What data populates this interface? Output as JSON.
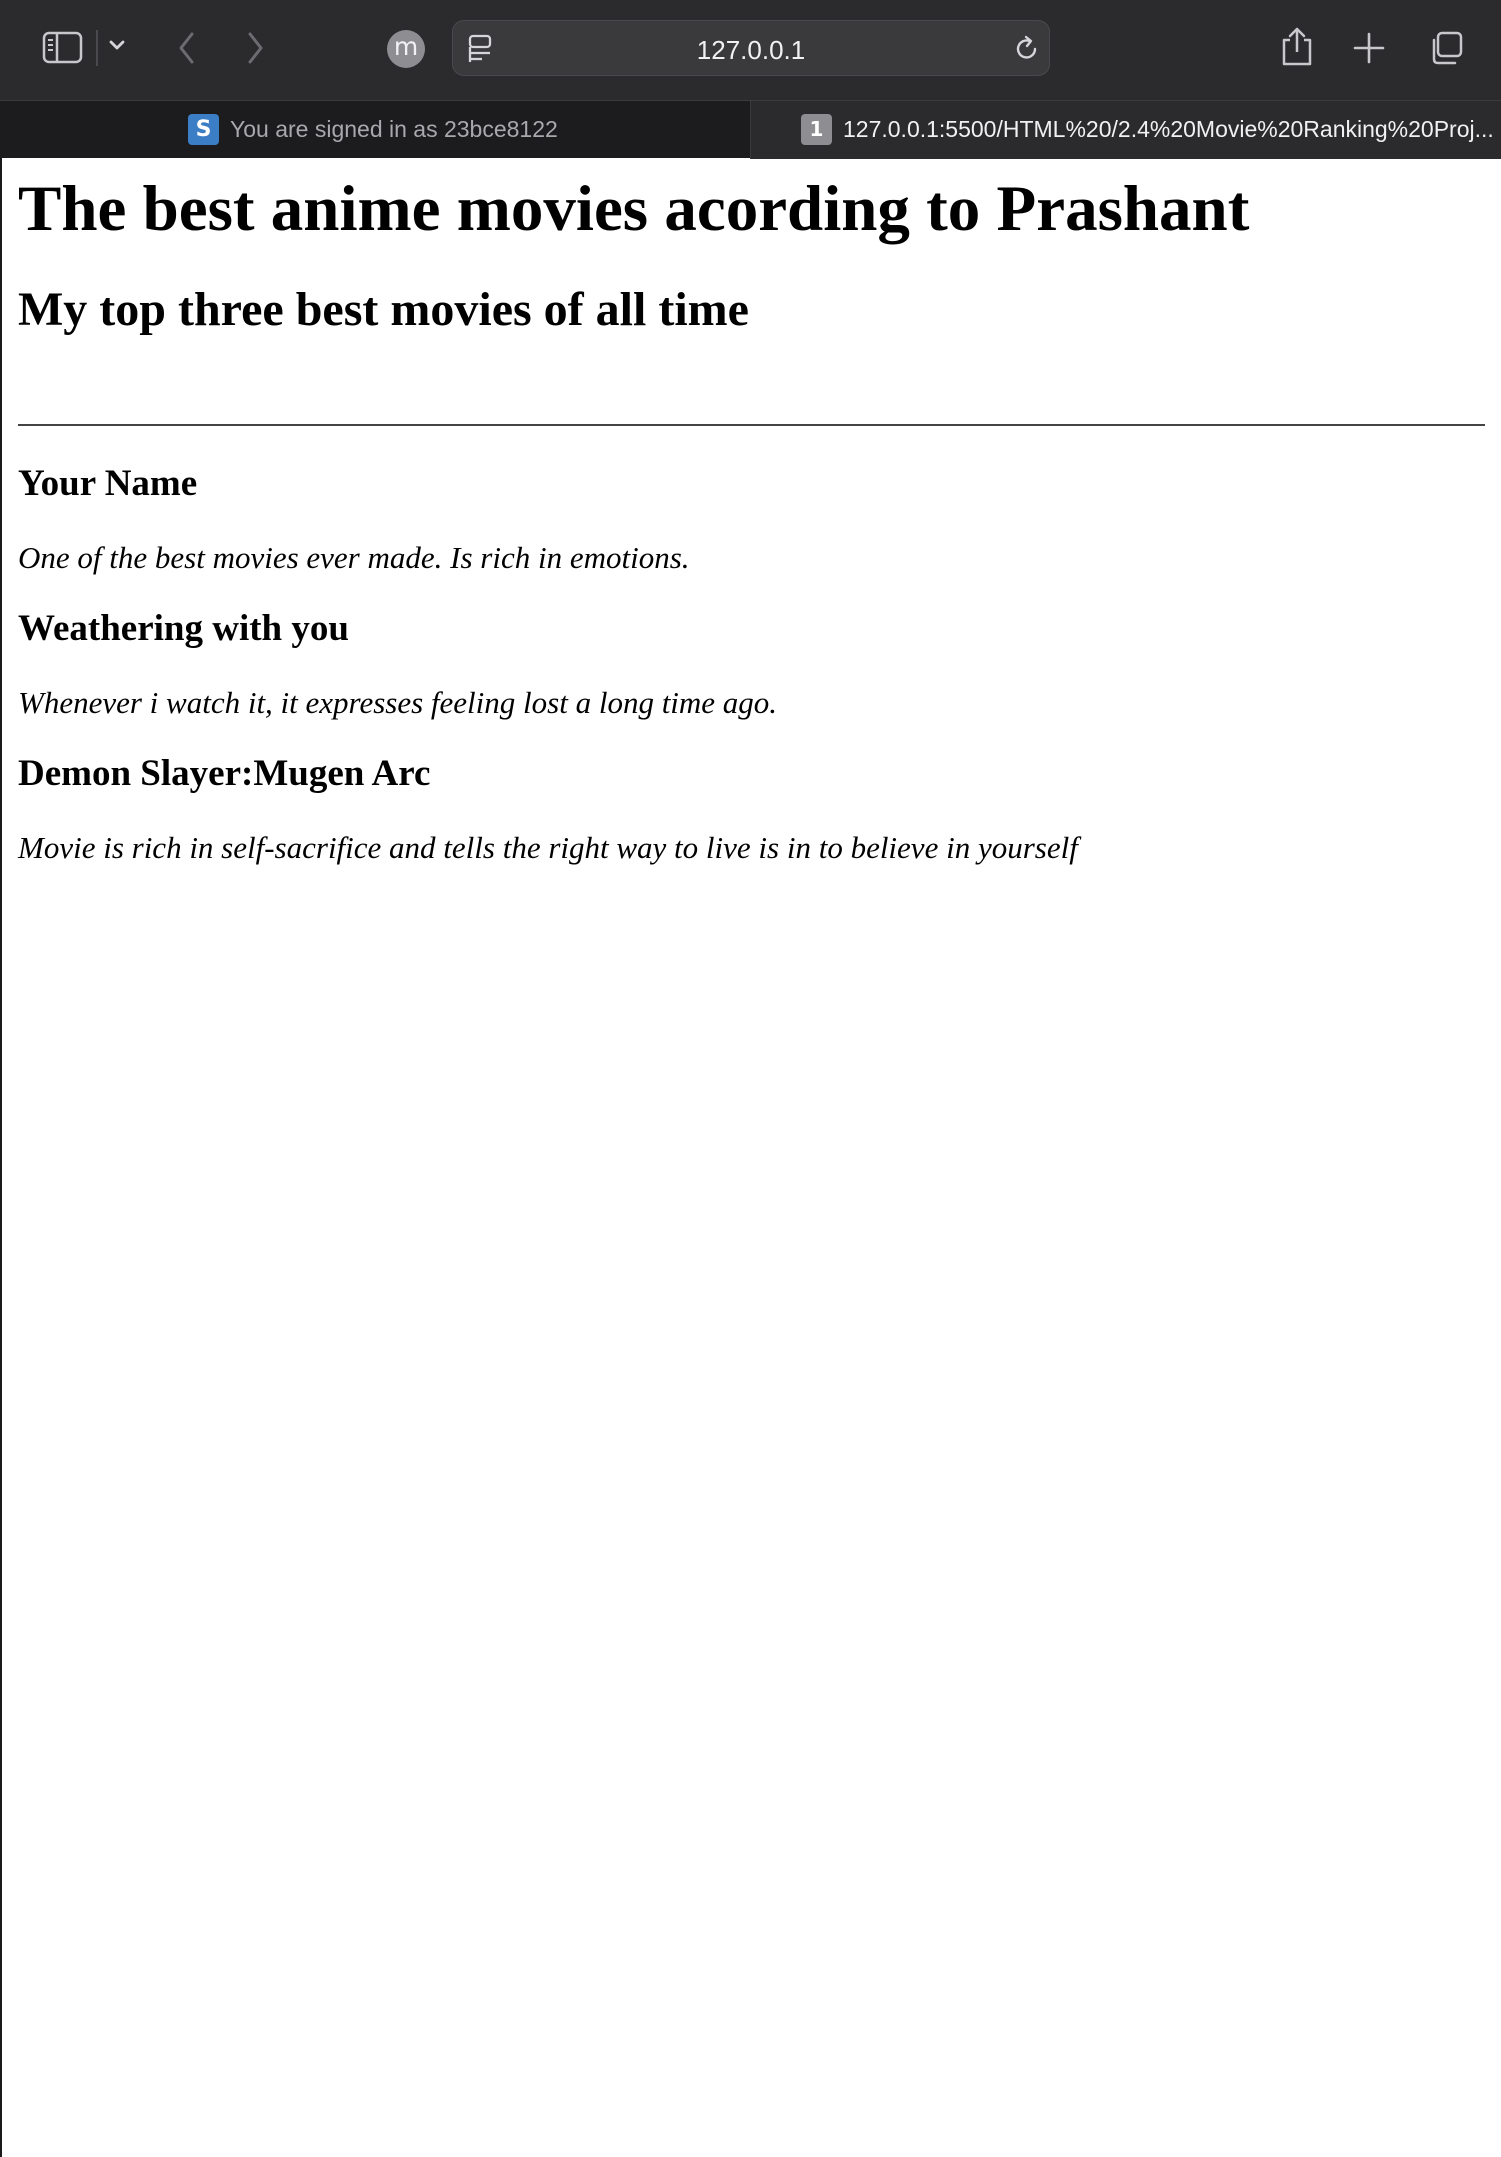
{
  "browser": {
    "profile_initial": "m",
    "url": "127.0.0.1",
    "tabs": [
      {
        "favicon": "S",
        "label": "You are signed in as 23bce8122",
        "active": false
      },
      {
        "favicon": "1",
        "label": "127.0.0.1:5500/HTML%20/2.4%20Movie%20Ranking%20Proj...",
        "active": true
      }
    ],
    "icons": [
      "sidebar-icon",
      "chevron-down-icon",
      "back-icon",
      "forward-icon",
      "page-menu-icon",
      "reload-icon",
      "share-icon",
      "new-tab-icon",
      "tab-overview-icon"
    ]
  },
  "page": {
    "title": "The best anime movies acording to Prashant",
    "subtitle": "My top three best movies of all time",
    "movies": [
      {
        "name": "Your Name",
        "description": "One of the best movies ever made. Is rich in emotions."
      },
      {
        "name": "Weathering with you",
        "description": "Whenever i watch it, it expresses feeling lost a long time ago."
      },
      {
        "name": "Demon Slayer:Mugen Arc",
        "description": "Movie is rich in self-sacrifice and tells the right way to live is in to believe in yourself"
      }
    ]
  }
}
